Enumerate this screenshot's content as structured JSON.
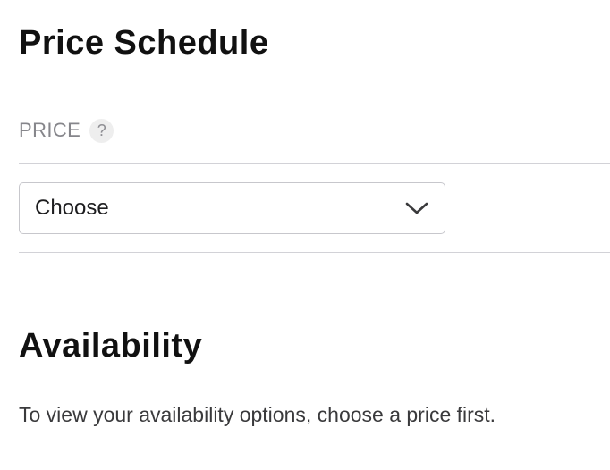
{
  "price_schedule": {
    "title": "Price Schedule",
    "price_label": "PRICE",
    "help_icon": "question-mark-icon",
    "help_glyph": "?",
    "select": {
      "value": "Choose",
      "icon": "chevron-down-icon"
    }
  },
  "availability": {
    "title": "Availability",
    "message": "To view your availability options, choose a price first."
  }
}
